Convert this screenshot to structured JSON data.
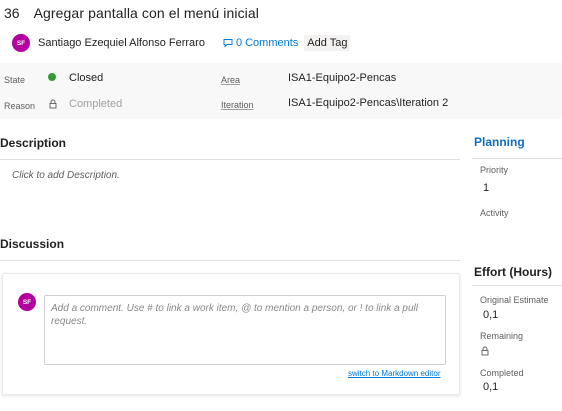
{
  "work_item": {
    "id": "36",
    "title": "Agregar pantalla con el menú inicial"
  },
  "meta": {
    "avatar_initials": "SF",
    "author": "Santiago Ezequiel Alfonso Ferraro",
    "comments_label": "0 Comments",
    "add_tag_label": "Add Tag"
  },
  "fields": {
    "state_label": "State",
    "state_value": "Closed",
    "reason_label": "Reason",
    "reason_value": "Completed",
    "area_label": "Area",
    "area_value": "ISA1-Equipo2-Pencas",
    "iteration_label": "Iteration",
    "iteration_value": "ISA1-Equipo2-Pencas\\Iteration 2"
  },
  "description": {
    "heading": "Description",
    "placeholder": "Click to add Description."
  },
  "discussion": {
    "heading": "Discussion",
    "avatar_initials": "SF",
    "comment_placeholder": "Add a comment. Use # to link a work item, @ to mention a person, or ! to link a pull request.",
    "markdown_link": "switch to Markdown editor"
  },
  "planning": {
    "heading": "Planning",
    "priority_label": "Priority",
    "priority_value": "1",
    "activity_label": "Activity"
  },
  "effort": {
    "heading": "Effort (Hours)",
    "original_estimate_label": "Original Estimate",
    "original_estimate_value": "0,1",
    "remaining_label": "Remaining",
    "completed_label": "Completed",
    "completed_value": "0,1"
  },
  "colors": {
    "state_closed": "#339933",
    "avatar": "#b4009e",
    "link": "#0078d4",
    "planning_heading": "#106ebe"
  }
}
